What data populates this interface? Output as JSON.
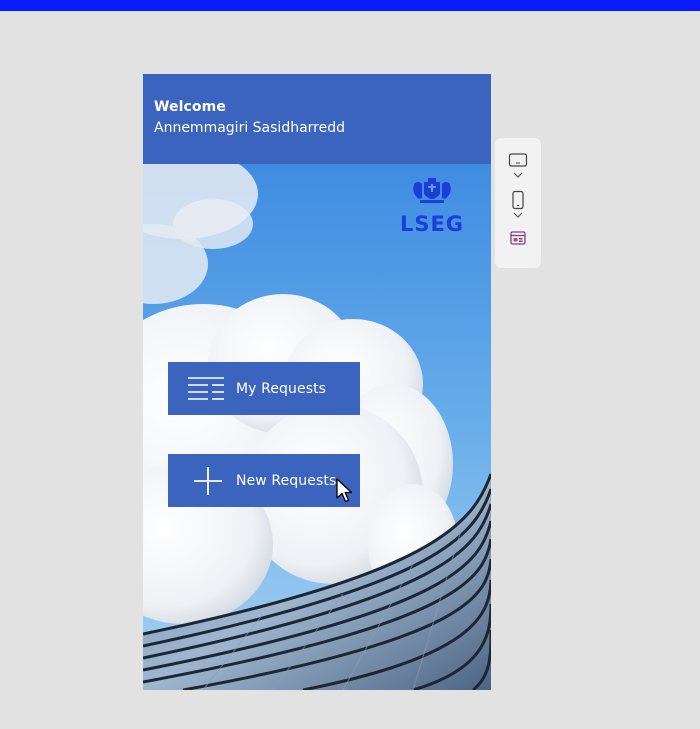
{
  "header": {
    "welcome": "Welcome",
    "user_name": "Annemmagiri Sasidharredd"
  },
  "logo": {
    "text": "LSEG",
    "icon": "coat-of-arms-icon",
    "color": "#1a3fd6"
  },
  "buttons": {
    "my_requests": {
      "label": "My Requests",
      "icon": "list-icon"
    },
    "new_requests": {
      "label": "New Requests",
      "icon": "plus-icon"
    }
  },
  "side_panel": {
    "items": [
      {
        "icon": "tablet-landscape-icon"
      },
      {
        "icon": "chevron-down-icon"
      },
      {
        "icon": "phone-portrait-icon"
      },
      {
        "icon": "chevron-down-icon"
      },
      {
        "icon": "app-window-icon"
      }
    ]
  },
  "colors": {
    "top_bar": "#0a1cff",
    "header_bg": "#3a64bd",
    "button_bg": "#3a64bd",
    "page_bg": "#e2e2e2",
    "panel_bg": "#f2f2f2"
  }
}
